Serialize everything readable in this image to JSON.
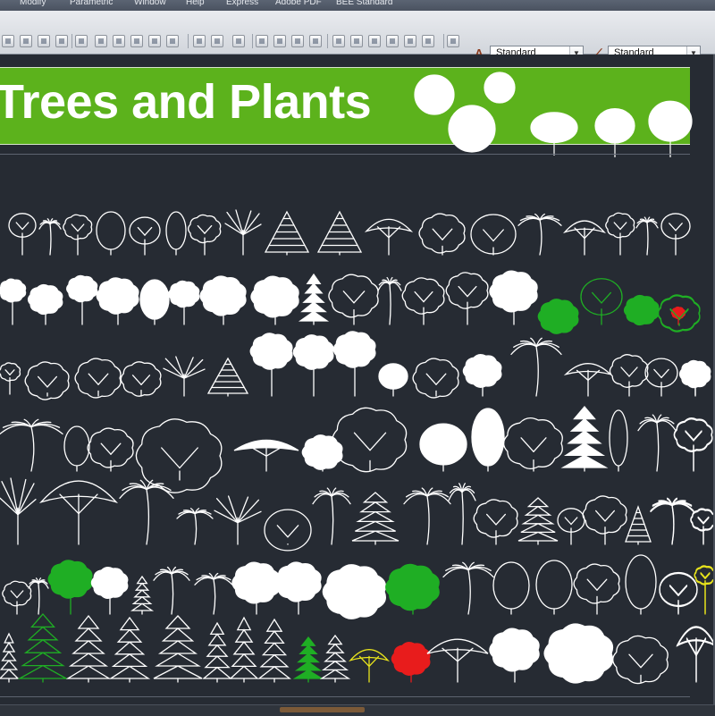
{
  "menu": [
    "Modify",
    "Parametric",
    "Window",
    "Help",
    "Express",
    "Adobe PDF",
    "BEE Standard"
  ],
  "toolbar": {
    "text_style": "Standard",
    "dim_style": "Standard"
  },
  "banner": {
    "title": "Trees and Plants"
  },
  "colors": {
    "background": "#262b33",
    "banner_green": "#5cb21c",
    "block_default": "#ffffff",
    "block_green": "#1fae24",
    "block_red": "#e81c1c",
    "block_yellow": "#e8e41c"
  }
}
